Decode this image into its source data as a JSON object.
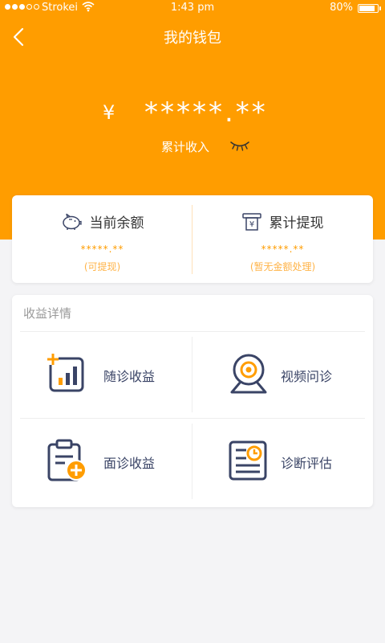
{
  "status_bar": {
    "carrier": "Strokei",
    "time": "1:43 pm",
    "battery": "80%",
    "battery_level": 0.8
  },
  "header": {
    "title": "我的钱包",
    "currency_symbol": "¥",
    "amount_masked": "*****.**",
    "income_label": "累计收入"
  },
  "balance": {
    "current": {
      "label": "当前余额",
      "value": "*****.**",
      "note": "(可提现)"
    },
    "withdrawn": {
      "label": "累计提现",
      "value": "*****.**",
      "note": "(暂无金额处理)"
    }
  },
  "details": {
    "title": "收益详情",
    "items": [
      {
        "label": "随诊收益",
        "icon": "followup-chart-icon"
      },
      {
        "label": "视频问诊",
        "icon": "webcam-icon"
      },
      {
        "label": "面诊收益",
        "icon": "clipboard-plus-icon"
      },
      {
        "label": "诊断评估",
        "icon": "report-clock-icon"
      }
    ]
  },
  "colors": {
    "accent": "#ff9d00",
    "icon_navy": "#3a4466",
    "background": "#f4f4f6"
  }
}
